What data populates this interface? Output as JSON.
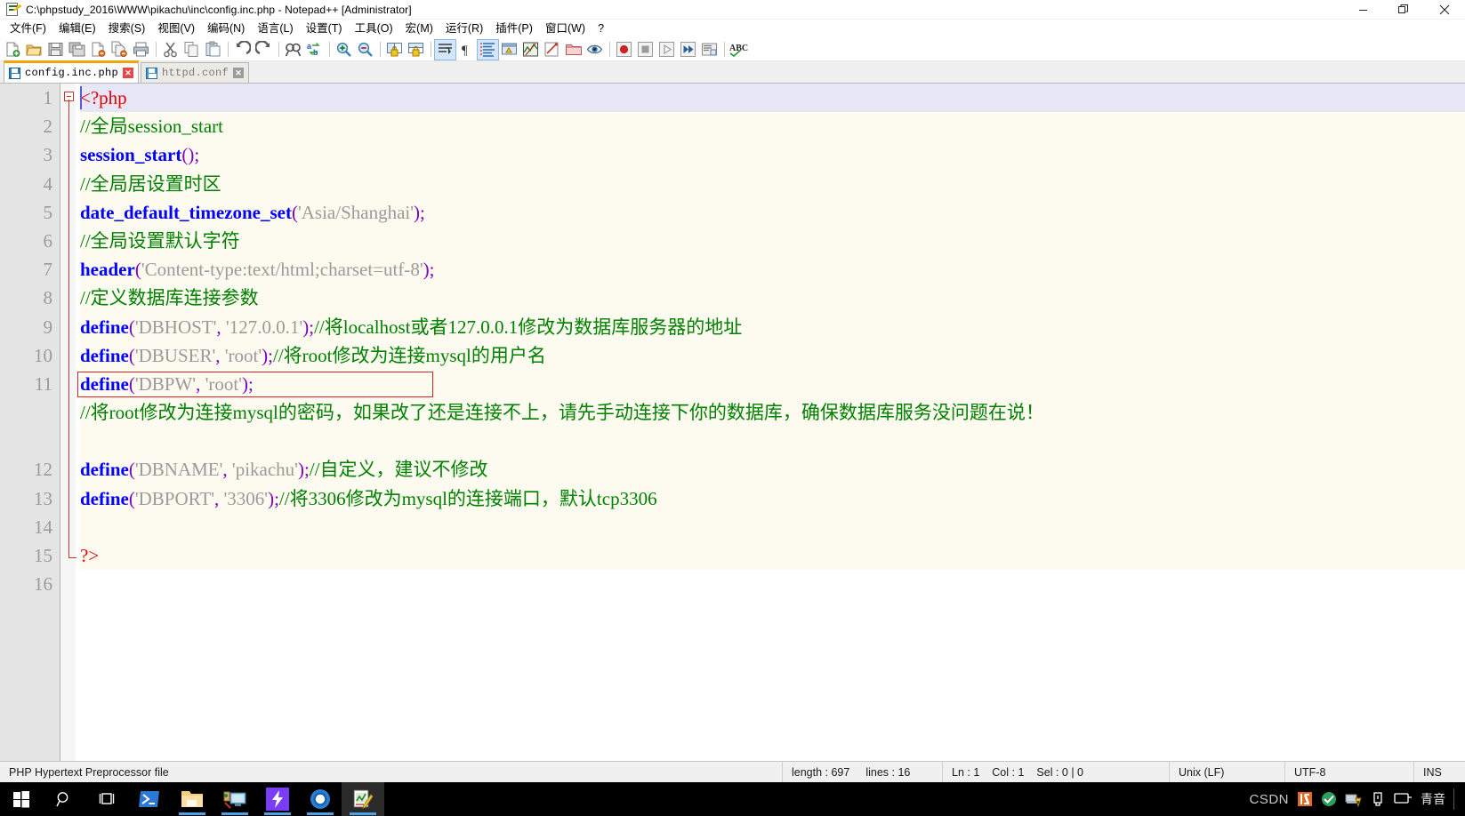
{
  "window": {
    "title": "C:\\phpstudy_2016\\WWW\\pikachu\\inc\\config.inc.php - Notepad++ [Administrator]",
    "icon": "notepad-plus-plus-icon",
    "minimize_label": "—",
    "maximize_label": "❐",
    "close_label": "✕"
  },
  "menubar": {
    "items": [
      {
        "label": "文件(F)",
        "name": "menu-file"
      },
      {
        "label": "编辑(E)",
        "name": "menu-edit"
      },
      {
        "label": "搜索(S)",
        "name": "menu-search"
      },
      {
        "label": "视图(V)",
        "name": "menu-view"
      },
      {
        "label": "编码(N)",
        "name": "menu-encoding"
      },
      {
        "label": "语言(L)",
        "name": "menu-language"
      },
      {
        "label": "设置(T)",
        "name": "menu-settings"
      },
      {
        "label": "工具(O)",
        "name": "menu-tools"
      },
      {
        "label": "宏(M)",
        "name": "menu-macro"
      },
      {
        "label": "运行(R)",
        "name": "menu-run"
      },
      {
        "label": "插件(P)",
        "name": "menu-plugins"
      },
      {
        "label": "窗口(W)",
        "name": "menu-window"
      },
      {
        "label": "?",
        "name": "menu-help"
      }
    ]
  },
  "toolbar": {
    "buttons": [
      "new-file-icon",
      "open-file-icon",
      "save-icon",
      "save-all-icon",
      "close-file-icon",
      "close-all-icon",
      "print-icon",
      "sep",
      "cut-icon",
      "copy-icon",
      "paste-icon",
      "sep",
      "undo-icon",
      "redo-icon",
      "sep",
      "find-icon",
      "replace-icon",
      "sep",
      "zoom-in-icon",
      "zoom-out-icon",
      "sep",
      "sync-vertical-scroll-icon",
      "sync-horizontal-scroll-icon",
      "sep",
      "word-wrap-icon",
      "show-all-chars-icon",
      "indent-guide-icon",
      "user-defined-language-icon",
      "document-map-icon",
      "function-list-icon",
      "folder-as-workspace-icon",
      "monitor-icon",
      "sep",
      "record-macro-icon",
      "stop-recording-icon",
      "play-macro-icon",
      "run-macro-multiple-icon",
      "save-macro-icon",
      "sep",
      "spell-check-icon"
    ]
  },
  "tabs": [
    {
      "label": "config.inc.php",
      "active": true,
      "name": "tab-config-inc-php",
      "icon": "saved-file-icon",
      "close": "✕"
    },
    {
      "label": "httpd.conf",
      "active": false,
      "name": "tab-httpd-conf",
      "icon": "saved-file-icon",
      "close": "✕"
    }
  ],
  "editor": {
    "line_numbers": [
      "1",
      "2",
      "3",
      "4",
      "5",
      "6",
      "7",
      "8",
      "9",
      "10",
      "11",
      "",
      "12",
      "13",
      "14",
      "15",
      "16"
    ],
    "annotation": {
      "type": "red-rectangle-highlight",
      "color": "#e02020",
      "targets_line": "11",
      "targets_text": "define('DBPW', 'root');"
    },
    "lines": [
      {
        "num": "1",
        "current": true,
        "tokens": [
          {
            "c": "t-tag",
            "t": "<?php"
          }
        ]
      },
      {
        "num": "2",
        "tokens": [
          {
            "c": "t-comment",
            "t": "//全局session_start"
          }
        ]
      },
      {
        "num": "3",
        "tokens": [
          {
            "c": "t-func",
            "t": "session_start"
          },
          {
            "c": "t-punct",
            "t": "();"
          }
        ]
      },
      {
        "num": "4",
        "tokens": [
          {
            "c": "t-comment",
            "t": "//全局居设置时区"
          }
        ]
      },
      {
        "num": "5",
        "tokens": [
          {
            "c": "t-func",
            "t": "date_default_timezone_set"
          },
          {
            "c": "t-punct",
            "t": "("
          },
          {
            "c": "t-str",
            "t": "'Asia/Shanghai'"
          },
          {
            "c": "t-punct",
            "t": ");"
          }
        ]
      },
      {
        "num": "6",
        "tokens": [
          {
            "c": "t-comment",
            "t": "//全局设置默认字符"
          }
        ]
      },
      {
        "num": "7",
        "tokens": [
          {
            "c": "t-func",
            "t": "header"
          },
          {
            "c": "t-punct",
            "t": "("
          },
          {
            "c": "t-str",
            "t": "'Content-type:text/html;charset=utf-8'"
          },
          {
            "c": "t-punct",
            "t": ");"
          }
        ]
      },
      {
        "num": "8",
        "tokens": [
          {
            "c": "t-comment",
            "t": "//定义数据库连接参数"
          }
        ]
      },
      {
        "num": "9",
        "tokens": [
          {
            "c": "t-func",
            "t": "define"
          },
          {
            "c": "t-punct",
            "t": "("
          },
          {
            "c": "t-str",
            "t": "'DBHOST'"
          },
          {
            "c": "t-punct",
            "t": ","
          },
          {
            "c": "t-str",
            "t": " '127.0.0.1'"
          },
          {
            "c": "t-punct",
            "t": ");"
          },
          {
            "c": "t-comment",
            "t": "//将localhost或者127.0.0.1修改为数据库服务器的地址"
          }
        ]
      },
      {
        "num": "10",
        "tokens": [
          {
            "c": "t-func",
            "t": "define"
          },
          {
            "c": "t-punct",
            "t": "("
          },
          {
            "c": "t-str",
            "t": "'DBUSER'"
          },
          {
            "c": "t-punct",
            "t": ","
          },
          {
            "c": "t-str",
            "t": " 'root'"
          },
          {
            "c": "t-punct",
            "t": ");"
          },
          {
            "c": "t-comment",
            "t": "//将root修改为连接mysql的用户名"
          }
        ]
      },
      {
        "num": "11",
        "boxed": true,
        "tokens": [
          {
            "c": "t-func",
            "t": "define"
          },
          {
            "c": "t-punct",
            "t": "("
          },
          {
            "c": "t-str",
            "t": "'DBPW'"
          },
          {
            "c": "t-punct",
            "t": ","
          },
          {
            "c": "t-str",
            "t": " 'root'"
          },
          {
            "c": "t-punct",
            "t": ");"
          }
        ]
      },
      {
        "num": "",
        "wrapped": true,
        "tokens": [
          {
            "c": "t-comment",
            "t": "//将root修改为连接mysql的密码，如果改了还是连接不上，请先手动连接下你的数据库，确保数据库服务没问题在说！"
          }
        ]
      },
      {
        "num": "12",
        "tokens": [
          {
            "c": "t-func",
            "t": "define"
          },
          {
            "c": "t-punct",
            "t": "("
          },
          {
            "c": "t-str",
            "t": "'DBNAME'"
          },
          {
            "c": "t-punct",
            "t": ","
          },
          {
            "c": "t-str",
            "t": " 'pikachu'"
          },
          {
            "c": "t-punct",
            "t": ");"
          },
          {
            "c": "t-comment",
            "t": "//自定义，建议不修改"
          }
        ]
      },
      {
        "num": "13",
        "tokens": [
          {
            "c": "t-func",
            "t": "define"
          },
          {
            "c": "t-punct",
            "t": "("
          },
          {
            "c": "t-str",
            "t": "'DBPORT'"
          },
          {
            "c": "t-punct",
            "t": ","
          },
          {
            "c": "t-str",
            "t": " '3306'"
          },
          {
            "c": "t-punct",
            "t": ");"
          },
          {
            "c": "t-comment",
            "t": "//将3306修改为mysql的连接端口，默认tcp3306"
          }
        ]
      },
      {
        "num": "14",
        "tokens": []
      },
      {
        "num": "15",
        "tokens": [
          {
            "c": "t-tag",
            "t": "?>"
          }
        ]
      },
      {
        "num": "16",
        "tokens": []
      }
    ]
  },
  "statusbar": {
    "doc_type": "PHP Hypertext Preprocessor file",
    "length": "length : 697",
    "lines": "lines : 16",
    "ln": "Ln : 1",
    "col": "Col : 1",
    "sel": "Sel : 0 | 0",
    "eol": "Unix (LF)",
    "encoding": "UTF-8",
    "insert_mode": "INS"
  },
  "taskbar": {
    "items": [
      {
        "name": "start-button",
        "icon": "windows-logo-icon",
        "running": false,
        "focused": false
      },
      {
        "name": "search-button",
        "icon": "search-icon",
        "running": false,
        "focused": false
      },
      {
        "name": "task-view-button",
        "icon": "task-view-icon",
        "running": false,
        "focused": false
      },
      {
        "name": "taskbar-powershell",
        "icon": "powershell-icon",
        "running": false,
        "focused": false
      },
      {
        "name": "taskbar-file-explorer",
        "icon": "file-explorer-icon",
        "running": true,
        "focused": false
      },
      {
        "name": "taskbar-remote-desktop",
        "icon": "remote-desktop-icon",
        "running": true,
        "focused": false
      },
      {
        "name": "taskbar-phpstudy",
        "icon": "phpstudy-icon",
        "running": true,
        "focused": false
      },
      {
        "name": "taskbar-chromium",
        "icon": "chromium-browser-icon",
        "running": true,
        "focused": false
      },
      {
        "name": "taskbar-notepadpp",
        "icon": "notepad-plus-plus-icon",
        "running": true,
        "focused": true
      }
    ],
    "tray": {
      "watermark": "CSDN",
      "icons": [
        "zip-icon",
        "antivirus-icon",
        "network-warning-icon",
        "usb-eject-icon",
        "display-icon"
      ],
      "ime_label": "青音"
    }
  },
  "colors": {
    "accent_tab": "#f0a30a",
    "annotation": "#e02020",
    "comment": "#008000",
    "function": "#0000ff",
    "punctuation": "#8000c0",
    "string": "#9a9a9a",
    "php_tag": "#e00000",
    "current_line": "#e6e6f7"
  }
}
